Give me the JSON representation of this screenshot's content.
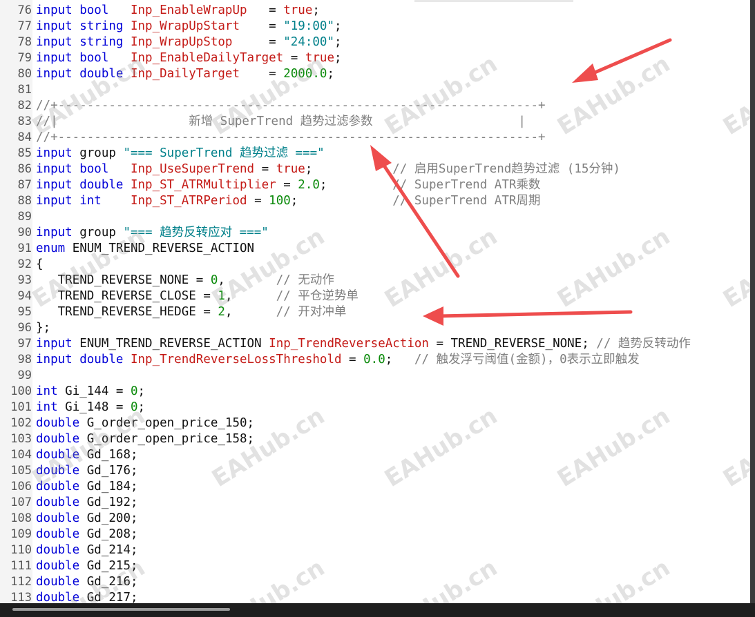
{
  "watermark_text": "EAHub.cn",
  "colors": {
    "keyword": "#0000d8",
    "identifier": "#c41a16",
    "string": "#00808a",
    "number": "#0a8a0a",
    "comment": "#7f7f7f",
    "arrow": "#ee4d4d"
  },
  "lines": [
    {
      "n": "76",
      "t": [
        [
          "kw",
          "input bool   "
        ],
        [
          "var",
          "Inp_EnableWrapUp"
        ],
        [
          "pl",
          "   = "
        ],
        [
          "var",
          "true"
        ],
        [
          "pl",
          ";"
        ]
      ]
    },
    {
      "n": "77",
      "t": [
        [
          "kw",
          "input string "
        ],
        [
          "var",
          "Inp_WrapUpStart"
        ],
        [
          "pl",
          "    = "
        ],
        [
          "str",
          "\"19:00\""
        ],
        [
          "pl",
          ";"
        ]
      ]
    },
    {
      "n": "78",
      "t": [
        [
          "kw",
          "input string "
        ],
        [
          "var",
          "Inp_WrapUpStop"
        ],
        [
          "pl",
          "     = "
        ],
        [
          "str",
          "\"24:00\""
        ],
        [
          "pl",
          ";"
        ]
      ]
    },
    {
      "n": "79",
      "t": [
        [
          "kw",
          "input bool   "
        ],
        [
          "var",
          "Inp_EnableDailyTarget"
        ],
        [
          "pl",
          " = "
        ],
        [
          "var",
          "true"
        ],
        [
          "pl",
          ";"
        ]
      ]
    },
    {
      "n": "80",
      "t": [
        [
          "kw",
          "input double "
        ],
        [
          "var",
          "Inp_DailyTarget"
        ],
        [
          "pl",
          "    = "
        ],
        [
          "num",
          "2000.0"
        ],
        [
          "pl",
          ";"
        ]
      ]
    },
    {
      "n": "81",
      "t": []
    },
    {
      "n": "82",
      "t": [
        [
          "cm",
          "//+------------------------------------------------------------------+"
        ]
      ]
    },
    {
      "n": "83",
      "t": [
        [
          "cm",
          "//|                  新增 SuperTrend 趋势过滤参数                    |"
        ]
      ]
    },
    {
      "n": "84",
      "t": [
        [
          "cm",
          "//+------------------------------------------------------------------+"
        ]
      ]
    },
    {
      "n": "85",
      "t": [
        [
          "kw",
          "input "
        ],
        [
          "pl",
          "group "
        ],
        [
          "str",
          "\"=== SuperTrend 趋势过滤 ===\""
        ]
      ]
    },
    {
      "n": "86",
      "t": [
        [
          "kw",
          "input bool   "
        ],
        [
          "var",
          "Inp_UseSuperTrend"
        ],
        [
          "pl",
          " = "
        ],
        [
          "var",
          "true"
        ],
        [
          "pl",
          ";"
        ],
        [
          "cm",
          "           // 启用SuperTrend趋势过滤 (15分钟)"
        ]
      ]
    },
    {
      "n": "87",
      "t": [
        [
          "kw",
          "input double "
        ],
        [
          "var",
          "Inp_ST_ATRMultiplier"
        ],
        [
          "pl",
          " = "
        ],
        [
          "num",
          "2.0"
        ],
        [
          "pl",
          ";"
        ],
        [
          "cm",
          "         // SuperTrend ATR乘数"
        ]
      ]
    },
    {
      "n": "88",
      "t": [
        [
          "kw",
          "input int    "
        ],
        [
          "var",
          "Inp_ST_ATRPeriod"
        ],
        [
          "pl",
          " = "
        ],
        [
          "num",
          "100"
        ],
        [
          "pl",
          ";"
        ],
        [
          "cm",
          "             // SuperTrend ATR周期"
        ]
      ]
    },
    {
      "n": "89",
      "t": []
    },
    {
      "n": "90",
      "t": [
        [
          "kw",
          "input "
        ],
        [
          "pl",
          "group "
        ],
        [
          "str",
          "\"=== 趋势反转应对 ===\""
        ]
      ]
    },
    {
      "n": "91",
      "t": [
        [
          "kw",
          "enum "
        ],
        [
          "pl",
          "ENUM_TREND_REVERSE_ACTION"
        ]
      ]
    },
    {
      "n": "92",
      "t": [
        [
          "pl",
          "{"
        ]
      ]
    },
    {
      "n": "93",
      "t": [
        [
          "pl",
          "   TREND_REVERSE_NONE = "
        ],
        [
          "num",
          "0"
        ],
        [
          "pl",
          ","
        ],
        [
          "cm",
          "       // 无动作"
        ]
      ]
    },
    {
      "n": "94",
      "t": [
        [
          "pl",
          "   TREND_REVERSE_CLOSE = "
        ],
        [
          "num",
          "1"
        ],
        [
          "pl",
          ","
        ],
        [
          "cm",
          "      // 平仓逆势单"
        ]
      ]
    },
    {
      "n": "95",
      "t": [
        [
          "pl",
          "   TREND_REVERSE_HEDGE = "
        ],
        [
          "num",
          "2"
        ],
        [
          "pl",
          ","
        ],
        [
          "cm",
          "      // 开对冲单"
        ]
      ]
    },
    {
      "n": "96",
      "t": [
        [
          "pl",
          "};"
        ]
      ]
    },
    {
      "n": "97",
      "t": [
        [
          "kw",
          "input "
        ],
        [
          "pl",
          "ENUM_TREND_REVERSE_ACTION "
        ],
        [
          "var",
          "Inp_TrendReverseAction"
        ],
        [
          "pl",
          " = TREND_REVERSE_NONE;"
        ],
        [
          "cm",
          " // 趋势反转动作"
        ]
      ]
    },
    {
      "n": "98",
      "t": [
        [
          "kw",
          "input double "
        ],
        [
          "var",
          "Inp_TrendReverseLossThreshold"
        ],
        [
          "pl",
          " = "
        ],
        [
          "num",
          "0.0"
        ],
        [
          "pl",
          ";"
        ],
        [
          "cm",
          "   // 触发浮亏阈值(金额)，0表示立即触发"
        ]
      ]
    },
    {
      "n": "99",
      "t": []
    },
    {
      "n": "100",
      "t": [
        [
          "kw",
          "int "
        ],
        [
          "pl",
          "Gi_144 = "
        ],
        [
          "num",
          "0"
        ],
        [
          "pl",
          ";"
        ]
      ]
    },
    {
      "n": "101",
      "t": [
        [
          "kw",
          "int "
        ],
        [
          "pl",
          "Gi_148 = "
        ],
        [
          "num",
          "0"
        ],
        [
          "pl",
          ";"
        ]
      ]
    },
    {
      "n": "102",
      "t": [
        [
          "kw",
          "double "
        ],
        [
          "pl",
          "G_order_open_price_150;"
        ]
      ]
    },
    {
      "n": "103",
      "t": [
        [
          "kw",
          "double "
        ],
        [
          "pl",
          "G_order_open_price_158;"
        ]
      ]
    },
    {
      "n": "104",
      "t": [
        [
          "kw",
          "double "
        ],
        [
          "pl",
          "Gd_168;"
        ]
      ]
    },
    {
      "n": "105",
      "t": [
        [
          "kw",
          "double "
        ],
        [
          "pl",
          "Gd_176;"
        ]
      ]
    },
    {
      "n": "106",
      "t": [
        [
          "kw",
          "double "
        ],
        [
          "pl",
          "Gd_184;"
        ]
      ]
    },
    {
      "n": "107",
      "t": [
        [
          "kw",
          "double "
        ],
        [
          "pl",
          "Gd_192;"
        ]
      ]
    },
    {
      "n": "108",
      "t": [
        [
          "kw",
          "double "
        ],
        [
          "pl",
          "Gd_200;"
        ]
      ]
    },
    {
      "n": "109",
      "t": [
        [
          "kw",
          "double "
        ],
        [
          "pl",
          "Gd_208;"
        ]
      ]
    },
    {
      "n": "110",
      "t": [
        [
          "kw",
          "double "
        ],
        [
          "pl",
          "Gd_214;"
        ]
      ]
    },
    {
      "n": "111",
      "t": [
        [
          "kw",
          "double "
        ],
        [
          "pl",
          "Gd_215;"
        ]
      ]
    },
    {
      "n": "112",
      "t": [
        [
          "kw",
          "double "
        ],
        [
          "pl",
          "Gd_216;"
        ]
      ]
    },
    {
      "n": "113",
      "t": [
        [
          "kw",
          "double "
        ],
        [
          "pl",
          "Gd_217;"
        ]
      ]
    }
  ]
}
